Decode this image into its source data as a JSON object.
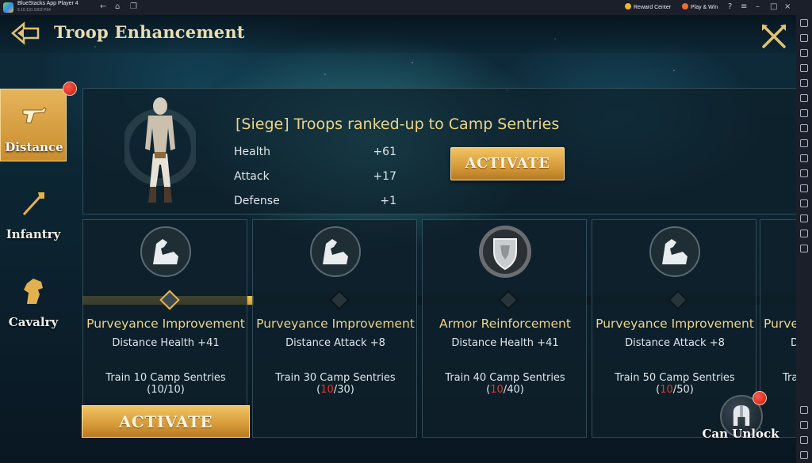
{
  "window": {
    "app_name": "BlueStacks App Player 4",
    "version": "5.10.110.1002  P64",
    "reward_center": "Reward Center",
    "play_win": "Play & Win"
  },
  "header": {
    "title": "Troop Enhancement"
  },
  "categories": [
    {
      "label": "Distance",
      "active": true,
      "badge": true
    },
    {
      "label": "Infantry",
      "active": false,
      "badge": false
    },
    {
      "label": "Cavalry",
      "active": false,
      "badge": false
    }
  ],
  "summary": {
    "title": "[Siege] Troops ranked-up to Camp Sentries",
    "stats": [
      {
        "name": "Health",
        "value": "+61"
      },
      {
        "name": "Attack",
        "value": "+17"
      },
      {
        "name": "Defense",
        "value": "+1"
      }
    ],
    "activate_label": "ACTIVATE"
  },
  "cards": [
    {
      "icon": "strength-arm-icon",
      "title": "Purveyance Improvement",
      "bonus": "Distance Health +41",
      "requirement": "Train 10 Camp Sentries",
      "progress_current": "10",
      "progress_total": "10",
      "complete": true
    },
    {
      "icon": "strength-arm-icon",
      "title": "Purveyance Improvement",
      "bonus": "Distance Attack +8",
      "requirement": "Train 30 Camp Sentries",
      "progress_current": "10",
      "progress_total": "30",
      "complete": false
    },
    {
      "icon": "armor-shield-icon",
      "title": "Armor Reinforcement",
      "bonus": "Distance Health +41",
      "requirement": "Train 40 Camp Sentries",
      "progress_current": "10",
      "progress_total": "40",
      "complete": false
    },
    {
      "icon": "strength-arm-icon",
      "title": "Purveyance Improvement",
      "bonus": "Distance Attack +8",
      "requirement": "Train 50 Camp Sentries",
      "progress_current": "10",
      "progress_total": "50",
      "complete": false
    },
    {
      "icon": "strength-arm-icon",
      "title": "Purve",
      "bonus": "D",
      "requirement": "Tra",
      "progress_current": "",
      "progress_total": "",
      "complete": false
    }
  ],
  "card_activate_label": "ACTIVATE",
  "unlock": {
    "label": "Can Unlock"
  },
  "colors": {
    "gold": "#ecd48a",
    "accent_button": "#d69a3a",
    "progress_red": "#e23a2a"
  }
}
